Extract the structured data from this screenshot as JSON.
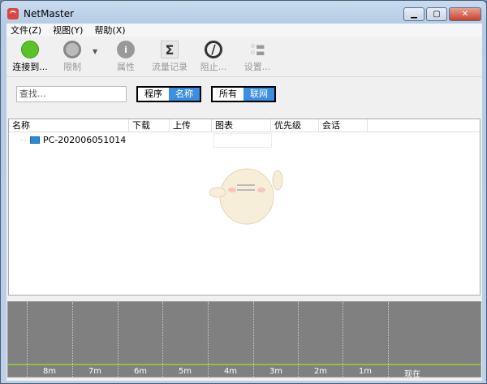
{
  "window": {
    "title": "NetMaster",
    "minimize": "▁",
    "maximize": "▢",
    "close": "✕"
  },
  "menu": [
    "文件(Z)",
    "视图(Y)",
    "帮助(X)"
  ],
  "toolbar": [
    {
      "label": "连接到...",
      "icon": "green-connect-circle",
      "enabled": true
    },
    {
      "label": "限制",
      "icon": "gauge-icon",
      "enabled": false
    },
    {
      "label": "属性",
      "icon": "info-icon",
      "enabled": false
    },
    {
      "label": "流量记录",
      "icon": "sigma-icon",
      "enabled": false
    },
    {
      "label": "阻止...",
      "icon": "block-icon",
      "enabled": true
    },
    {
      "label": "设置...",
      "icon": "settings-list-icon",
      "enabled": false
    }
  ],
  "search": {
    "placeholder": "查找..."
  },
  "toggle1": {
    "options": [
      "程序",
      "名称"
    ],
    "selected": "名称"
  },
  "toggle2": {
    "options": [
      "所有",
      "联网"
    ],
    "selected": "联网"
  },
  "table": {
    "columns": [
      "名称",
      "下载",
      "上传",
      "图表",
      "优先级",
      "会话"
    ],
    "rows": [
      {
        "name": "PC-202006051014"
      }
    ]
  },
  "graph": {
    "labels": [
      "8m",
      "7m",
      "6m",
      "5m",
      "4m",
      "3m",
      "2m",
      "1m",
      "现在"
    ],
    "line_color": "#8fbf3f"
  },
  "colors": {
    "accent": "#3b8fe0",
    "graph_bg": "#808080"
  }
}
